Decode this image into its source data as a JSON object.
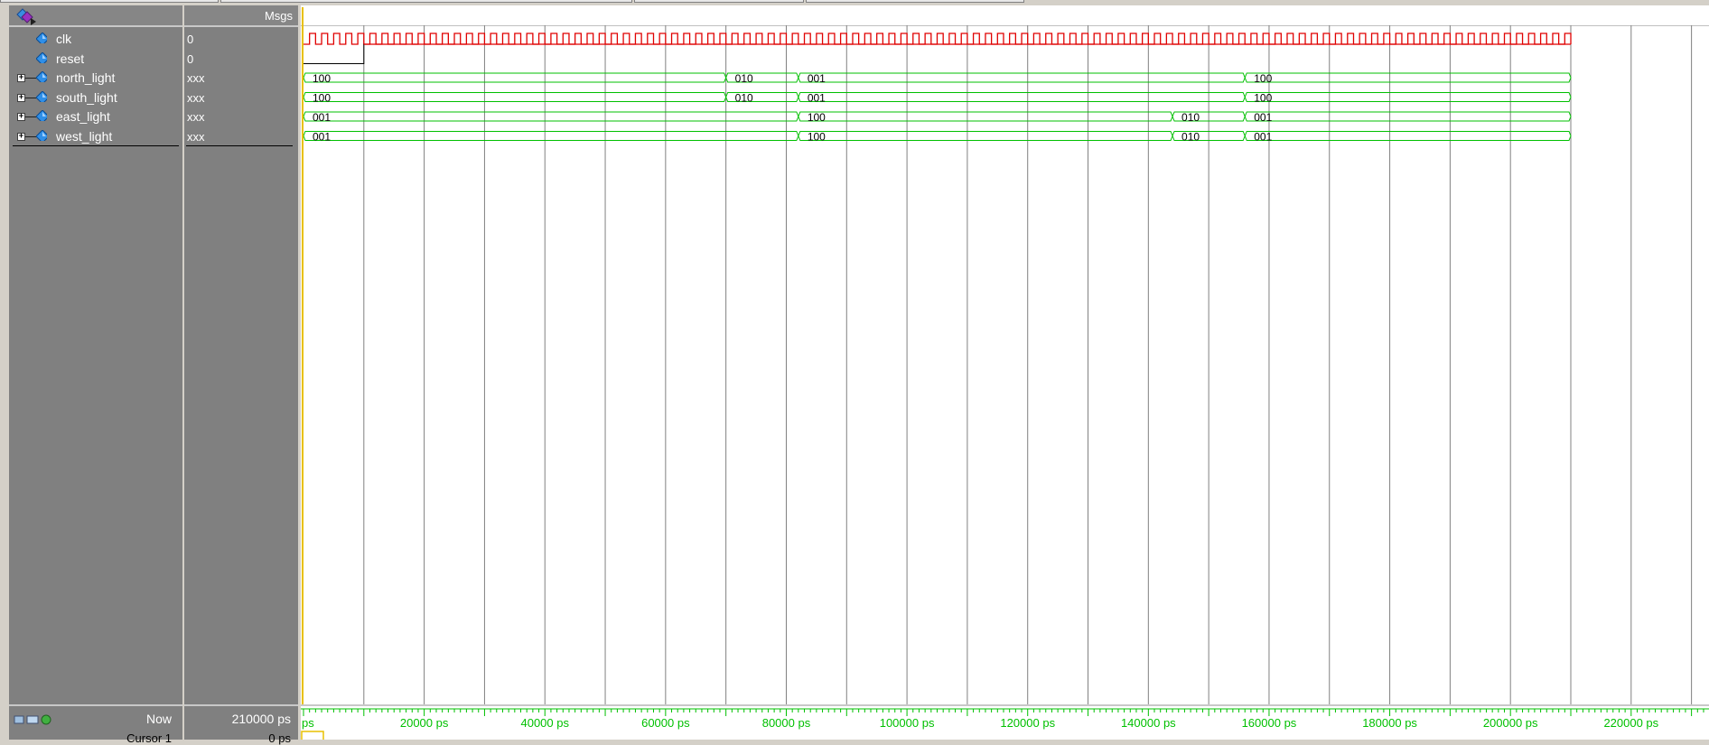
{
  "toolbar": {
    "dropdown_icon": "wave-objects-icon"
  },
  "headers": {
    "msgs": "Msgs"
  },
  "signals": [
    {
      "name": "clk",
      "value": "0",
      "expandable": false
    },
    {
      "name": "reset",
      "value": "0",
      "expandable": false
    },
    {
      "name": "north_light",
      "value": "xxx",
      "expandable": true
    },
    {
      "name": "south_light",
      "value": "xxx",
      "expandable": true
    },
    {
      "name": "east_light",
      "value": "xxx",
      "expandable": true
    },
    {
      "name": "west_light",
      "value": "xxx",
      "expandable": true
    }
  ],
  "buses": [
    {
      "signal": "north_light",
      "segments": [
        {
          "t0": 0,
          "t1": 70000,
          "label": "100"
        },
        {
          "t0": 70000,
          "t1": 82000,
          "label": "010"
        },
        {
          "t0": 82000,
          "t1": 156000,
          "label": "001"
        },
        {
          "t0": 156000,
          "t1": 210000,
          "label": "100"
        }
      ]
    },
    {
      "signal": "south_light",
      "segments": [
        {
          "t0": 0,
          "t1": 70000,
          "label": "100"
        },
        {
          "t0": 70000,
          "t1": 82000,
          "label": "010"
        },
        {
          "t0": 82000,
          "t1": 156000,
          "label": "001"
        },
        {
          "t0": 156000,
          "t1": 210000,
          "label": "100"
        }
      ]
    },
    {
      "signal": "east_light",
      "segments": [
        {
          "t0": 0,
          "t1": 82000,
          "label": "001"
        },
        {
          "t0": 82000,
          "t1": 144000,
          "label": "100"
        },
        {
          "t0": 144000,
          "t1": 156000,
          "label": "010"
        },
        {
          "t0": 156000,
          "t1": 210000,
          "label": "001"
        }
      ]
    },
    {
      "signal": "west_light",
      "segments": [
        {
          "t0": 0,
          "t1": 82000,
          "label": "001"
        },
        {
          "t0": 82000,
          "t1": 144000,
          "label": "100"
        },
        {
          "t0": 144000,
          "t1": 156000,
          "label": "010"
        },
        {
          "t0": 156000,
          "t1": 210000,
          "label": "001"
        }
      ]
    }
  ],
  "reset_deassert_ps": 10000,
  "clock_period_ps": 2000,
  "sim_end_ps": 210000,
  "timeline": {
    "ticks": [
      "20000 ps",
      "40000 ps",
      "60000 ps",
      "80000 ps",
      "100000 ps",
      "120000 ps",
      "140000 ps",
      "160000 ps",
      "180000 ps",
      "200000 ps",
      "220000 ps"
    ],
    "tick_values": [
      20000,
      40000,
      60000,
      80000,
      100000,
      120000,
      140000,
      160000,
      180000,
      200000,
      220000
    ],
    "first_label": "ps"
  },
  "status": {
    "now_label": "Now",
    "now_value": "210000 ps",
    "cursor_label": "Cursor 1",
    "cursor_value": "0 ps"
  },
  "colors": {
    "clock": "#e00000",
    "bus": "#00c000",
    "grid": "#808080",
    "cursor": "#e8c000",
    "timeline_text": "#00c000"
  }
}
